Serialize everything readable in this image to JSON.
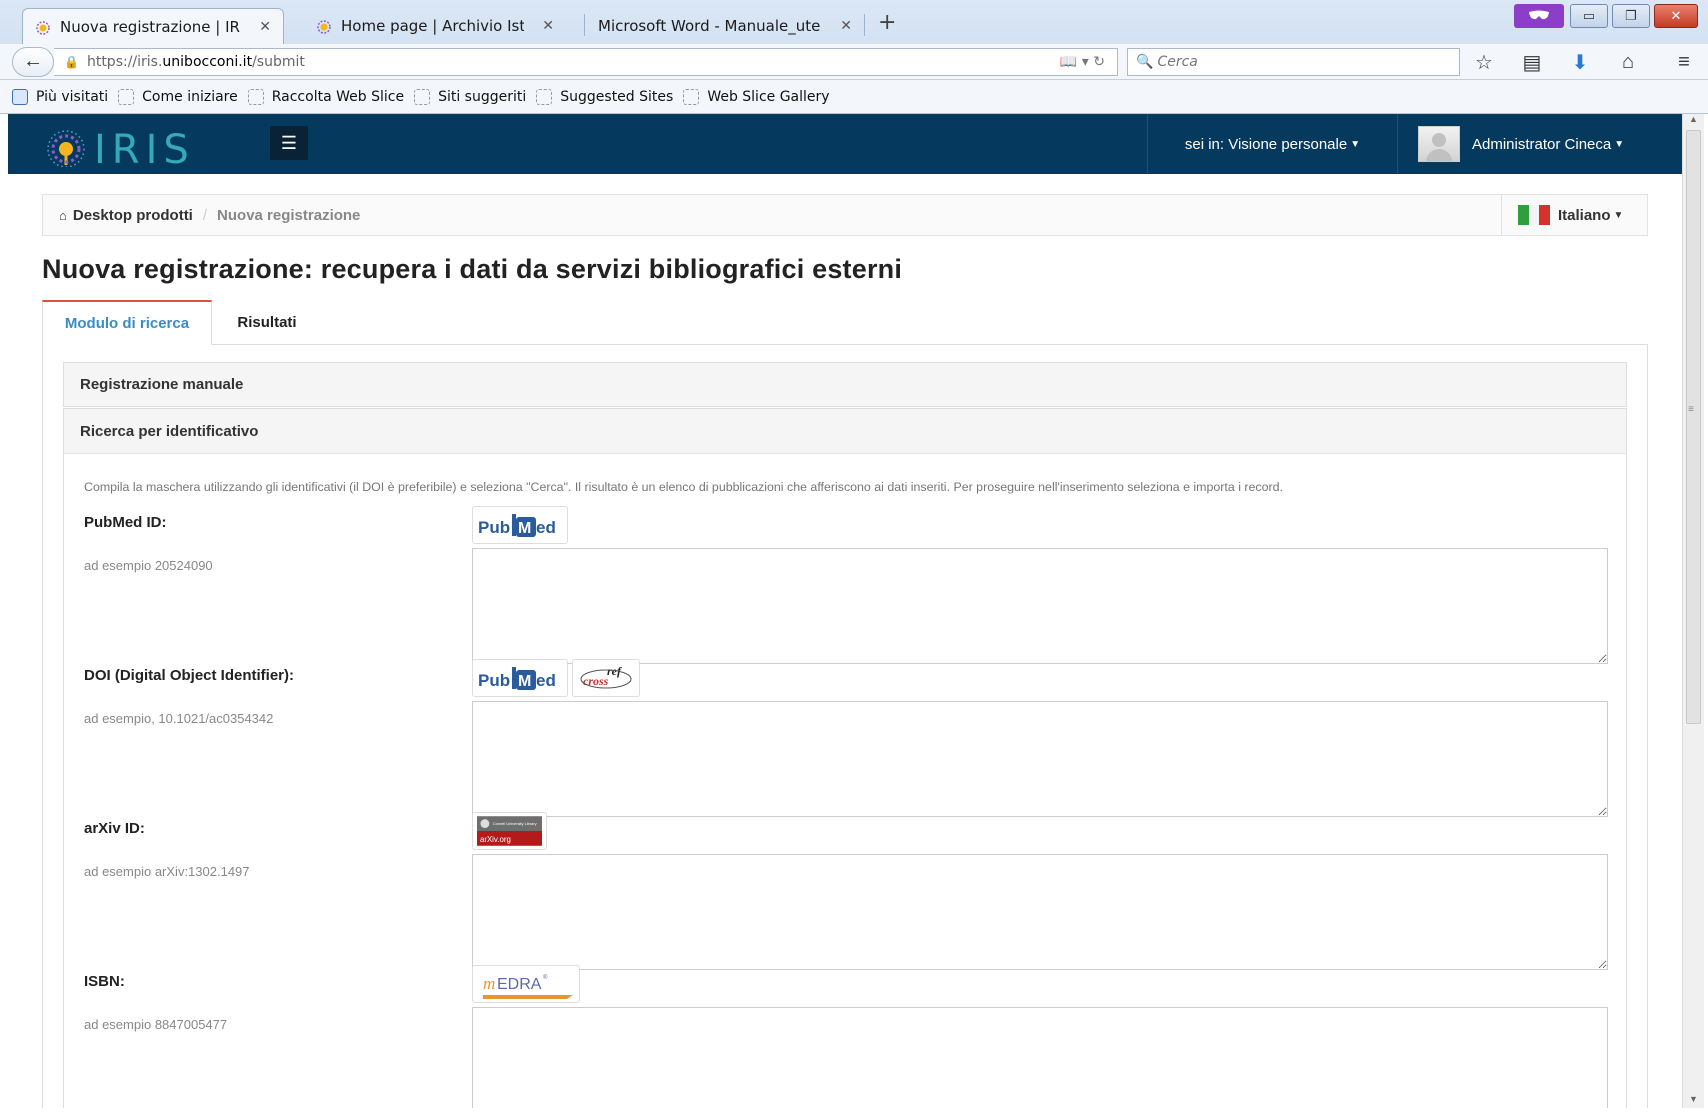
{
  "browser": {
    "tabs": [
      {
        "title": "Nuova registrazione | IRIS ...",
        "active": true
      },
      {
        "title": "Home page | Archivio Istit...",
        "active": false
      },
      {
        "title": "Microsoft Word - Manuale_ute...",
        "active": false
      }
    ],
    "new_tab_label": "+",
    "url": {
      "scheme_prefix": "https://iris.",
      "host": "unibocconi.it",
      "path": "/submit"
    },
    "search_placeholder": "Cerca",
    "bookmarks": [
      "Più visitati",
      "Come iniziare",
      "Raccolta Web Slice",
      "Siti suggeriti",
      "Suggested Sites",
      "Web Slice Gallery"
    ],
    "toolbar_icons": [
      "star-icon",
      "reading-list-icon",
      "download-icon",
      "home-icon",
      "hamburger-menu-icon"
    ]
  },
  "app": {
    "logo_text": "IRIS",
    "context_label": "sei in: Visione personale",
    "user_name": "Administrator Cineca",
    "colors": {
      "header": "#053a5e",
      "active_tab_text": "#3a8dc3",
      "active_tab_border": "#e0503d"
    }
  },
  "breadcrumb": {
    "home": "Desktop prodotti",
    "separator": "/",
    "current": "Nuova registrazione"
  },
  "language": {
    "label": "Italiano"
  },
  "page": {
    "title": "Nuova registrazione: recupera i dati da servizi bibliografici esterni",
    "tabs": [
      "Modulo di ricerca",
      "Risultati"
    ]
  },
  "accordion": {
    "manual": "Registrazione manuale",
    "identifier": "Ricerca per identificativo",
    "intro": "Compila la maschera utilizzando gli identificativi (il DOI è preferibile) e seleziona \"Cerca\". Il risultato è un elenco di pubblicazioni che afferiscono ai dati inseriti. Per proseguire nell'inserimento seleziona e importa i record."
  },
  "fields": [
    {
      "label": "PubMed ID:",
      "hint": "ad esempio 20524090",
      "services": [
        "PubMed"
      ],
      "value": ""
    },
    {
      "label": "DOI (Digital Object Identifier):",
      "hint": "ad esempio, 10.1021/ac0354342",
      "services": [
        "PubMed",
        "CrossRef"
      ],
      "value": ""
    },
    {
      "label": "arXiv ID:",
      "hint": "ad esempio arXiv:1302.1497",
      "services": [
        "arXiv.org"
      ],
      "value": ""
    },
    {
      "label": "ISBN:",
      "hint": "ad esempio 8847005477",
      "services": [
        "mEDRA"
      ],
      "value": ""
    }
  ],
  "service_logos": {
    "pubmed": {
      "left": "Pub",
      "mid": "M",
      "right": "ed"
    },
    "crossref": {
      "top": "ref",
      "bottom": "cross"
    },
    "arxiv": {
      "caption": "arXiv.org",
      "header": "Cornell University Library"
    },
    "medra": {
      "m": "m",
      "rest": "EDRA",
      "mark": "®"
    }
  }
}
